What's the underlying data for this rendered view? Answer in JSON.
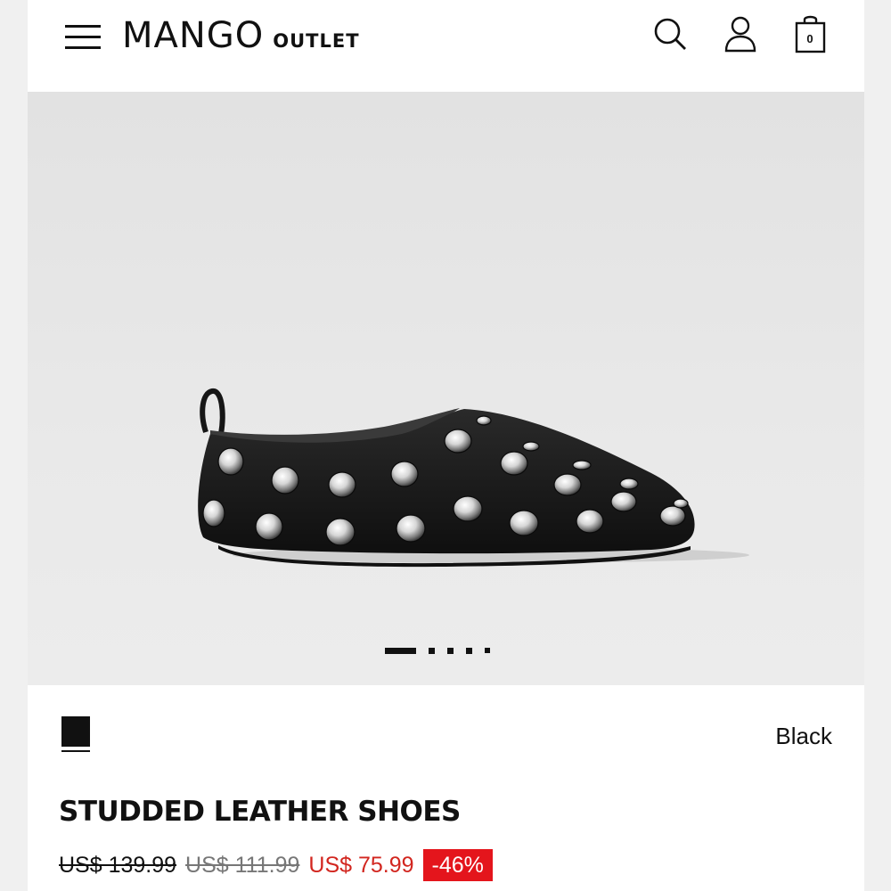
{
  "header": {
    "brand": "MANGO",
    "brand_sub": "OUTLET",
    "bag_count": "0",
    "icons": [
      "menu-icon",
      "search-icon",
      "user-icon",
      "shopping-bag-icon"
    ]
  },
  "gallery": {
    "image_alt": "studded-leather-shoe-photo",
    "slide_count": 5,
    "active_slide": 1
  },
  "product": {
    "color_name": "Black",
    "swatch_color": "#111111",
    "title": "STUDDED LEATHER SHOES",
    "price_original": "US$ 139.99",
    "price_previous": "US$ 111.99",
    "price_current": "US$ 75.99",
    "discount": "-46%"
  },
  "colors": {
    "sale_red": "#d2261f",
    "badge_red": "#e4151c",
    "text": "#111111"
  }
}
